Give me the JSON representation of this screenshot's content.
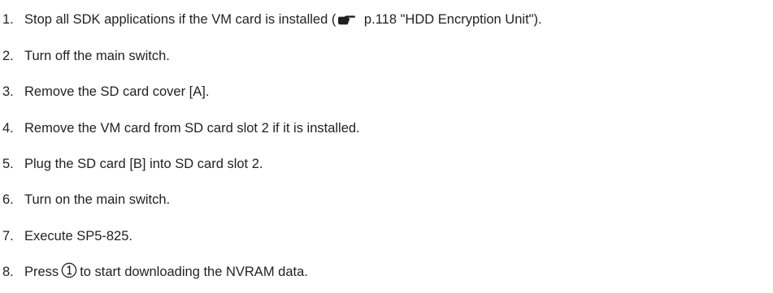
{
  "steps": [
    {
      "number": "1.",
      "text_before": "Stop all SDK applications if the VM card is installed (",
      "icon": "pointing-hand-icon",
      "text_after": " p.118 \"HDD Encryption Unit\")."
    },
    {
      "number": "2.",
      "text": "Turn off the main switch."
    },
    {
      "number": "3.",
      "text": "Remove the SD card cover [A]."
    },
    {
      "number": "4.",
      "text": "Remove the VM card from SD card slot 2 if it is installed."
    },
    {
      "number": "5.",
      "text": "Plug the SD card [B] into SD card slot 2."
    },
    {
      "number": "6.",
      "text": "Turn on the main switch."
    },
    {
      "number": "7.",
      "text": "Execute SP5-825."
    },
    {
      "number": "8.",
      "text_before": "Press",
      "icon": "start-key-icon",
      "text_after": "to start downloading the NVRAM data."
    }
  ],
  "colors": {
    "text": "#231f20",
    "background": "#ffffff"
  }
}
